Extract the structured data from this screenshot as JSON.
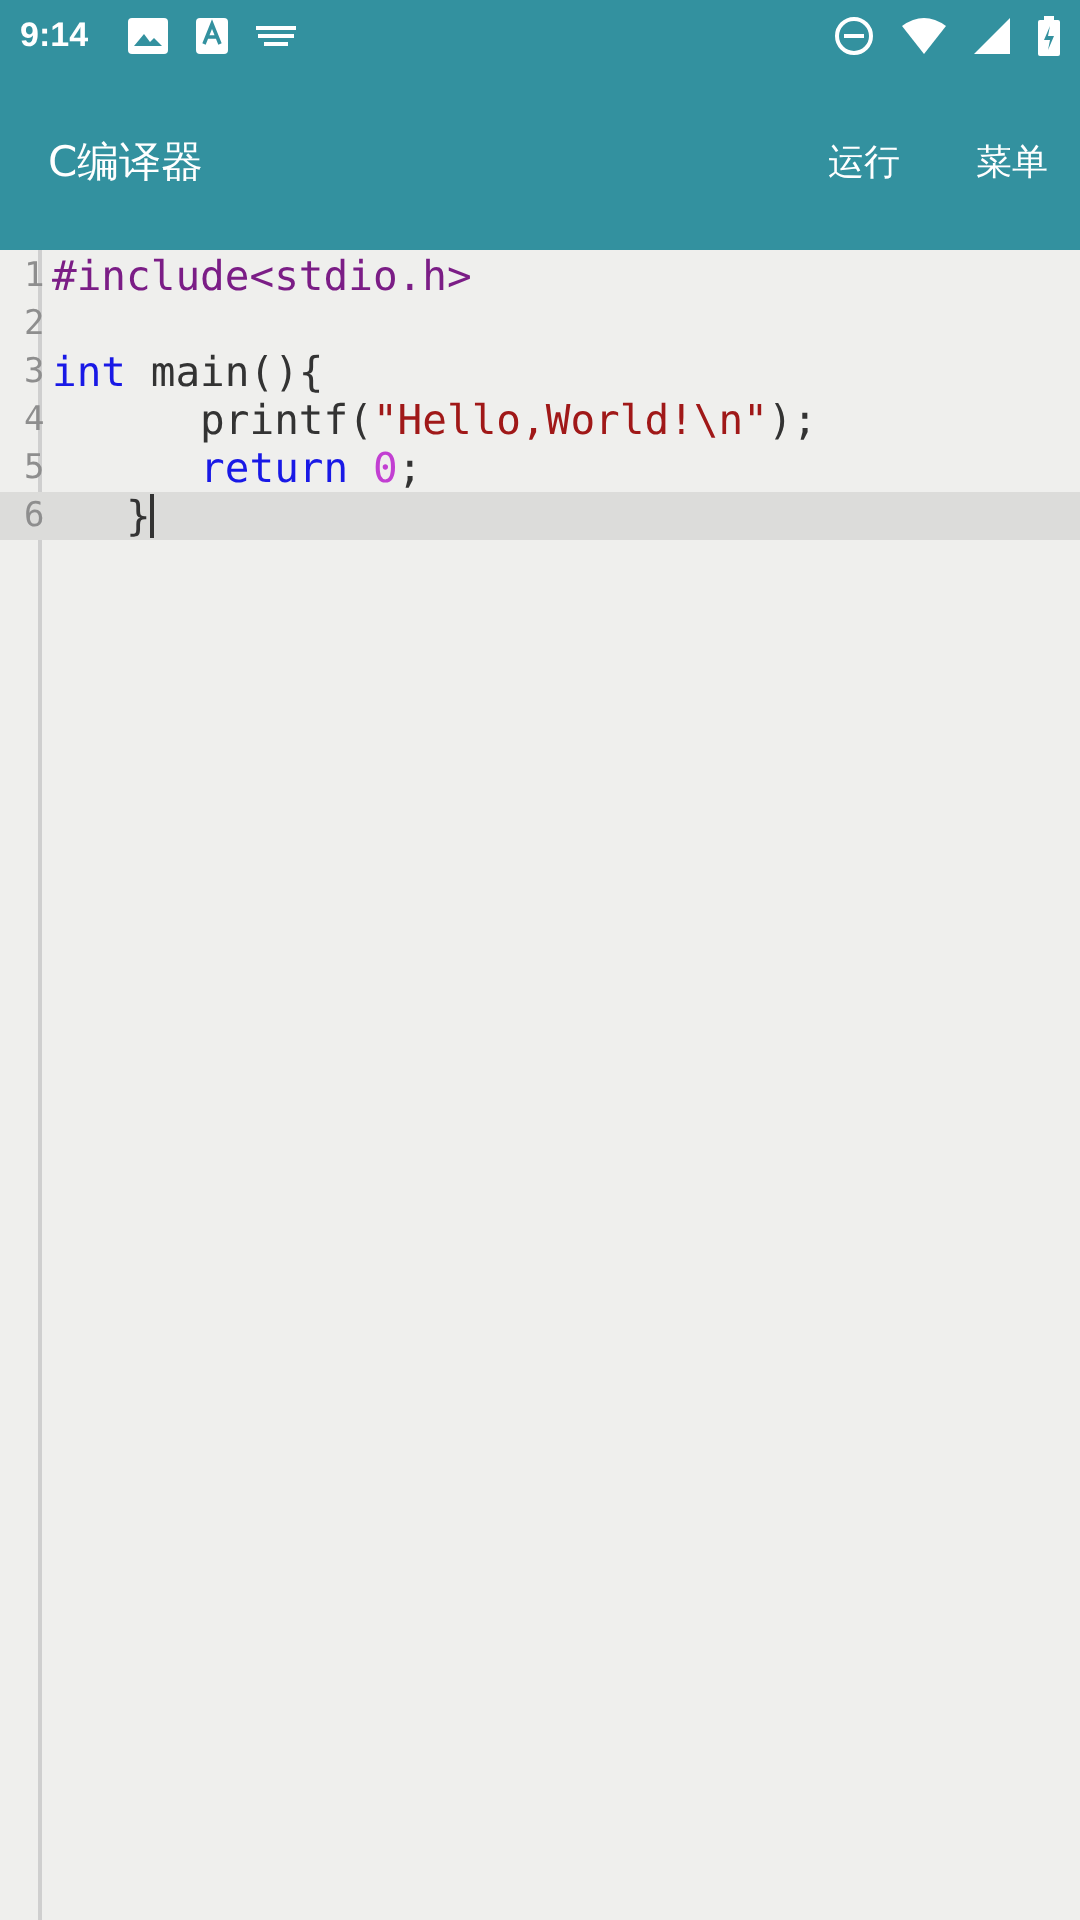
{
  "status_bar": {
    "time": "9:14"
  },
  "app_bar": {
    "title": "C编译器",
    "actions": [
      "运行",
      "菜单"
    ]
  },
  "editor": {
    "lines": [
      {
        "number": "1",
        "current": false,
        "tokens": [
          {
            "kind": "preprocessor",
            "text": "#include<stdio.h>"
          }
        ]
      },
      {
        "number": "2",
        "current": false
      },
      {
        "number": "3",
        "current": false,
        "tokens": [
          {
            "kind": "keyword",
            "text": "int"
          },
          {
            "kind": "plain",
            "text": " main(){"
          }
        ]
      },
      {
        "number": "4",
        "current": false,
        "tokens": [
          {
            "kind": "plain",
            "text": "      printf("
          },
          {
            "kind": "string",
            "text": "\"Hello,World!\\n\""
          },
          {
            "kind": "plain",
            "text": ");"
          }
        ]
      },
      {
        "number": "5",
        "current": false,
        "tokens": [
          {
            "kind": "keyword",
            "text": "      return "
          },
          {
            "kind": "number",
            "text": "0"
          },
          {
            "kind": "plain",
            "text": ";"
          }
        ]
      },
      {
        "number": "6",
        "current": true,
        "tokens": [
          {
            "kind": "plain",
            "text": "   }"
          }
        ]
      }
    ]
  }
}
